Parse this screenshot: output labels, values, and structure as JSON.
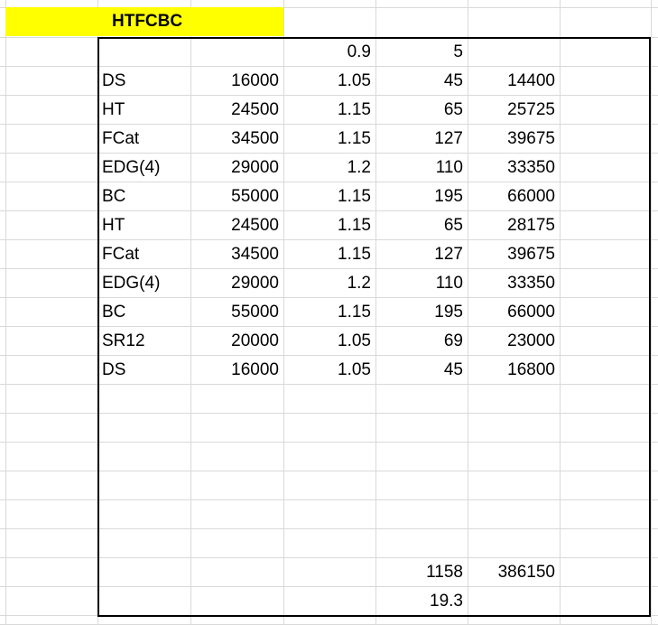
{
  "sheet": {
    "title": "HTFCBC",
    "header_row": [
      "",
      "",
      "0.9",
      "5",
      ""
    ],
    "rows": [
      [
        "DS",
        "16000",
        "1.05",
        "45",
        "14400"
      ],
      [
        "HT",
        "24500",
        "1.15",
        "65",
        "25725"
      ],
      [
        "FCat",
        "34500",
        "1.15",
        "127",
        "39675"
      ],
      [
        "EDG(4)",
        "29000",
        "1.2",
        "110",
        "33350"
      ],
      [
        "BC",
        "55000",
        "1.15",
        "195",
        "66000"
      ],
      [
        "HT",
        "24500",
        "1.15",
        "65",
        "28175"
      ],
      [
        "FCat",
        "34500",
        "1.15",
        "127",
        "39675"
      ],
      [
        "EDG(4)",
        "29000",
        "1.2",
        "110",
        "33350"
      ],
      [
        "BC",
        "55000",
        "1.15",
        "195",
        "66000"
      ],
      [
        "SR12",
        "20000",
        "1.05",
        "69",
        "23000"
      ],
      [
        "DS",
        "16000",
        "1.05",
        "45",
        "16800"
      ]
    ],
    "totals": {
      "count_total": "1158",
      "value_total": "386150",
      "average": "19.3"
    }
  }
}
